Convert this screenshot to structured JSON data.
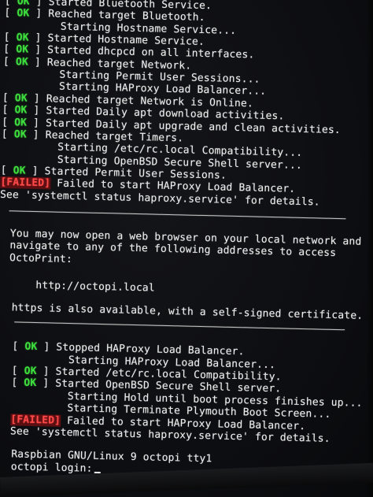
{
  "terminal": {
    "status_ok": "OK",
    "status_failed": "FAILED",
    "lines": [
      {
        "status": "ok",
        "text": "Started Bluetooth Service."
      },
      {
        "status": "ok",
        "text": "Reached target Bluetooth."
      },
      {
        "status": "none",
        "text": "Starting Hostname Service..."
      },
      {
        "status": "ok",
        "text": "Started Hostname Service."
      },
      {
        "status": "ok",
        "text": "Started dhcpcd on all interfaces."
      },
      {
        "status": "ok",
        "text": "Reached target Network."
      },
      {
        "status": "none",
        "text": "Starting Permit User Sessions..."
      },
      {
        "status": "none",
        "text": "Starting HAProxy Load Balancer..."
      },
      {
        "status": "ok",
        "text": "Reached target Network is Online."
      },
      {
        "status": "ok",
        "text": "Started Daily apt download activities."
      },
      {
        "status": "ok",
        "text": "Started Daily apt upgrade and clean activities."
      },
      {
        "status": "ok",
        "text": "Reached target Timers."
      },
      {
        "status": "none",
        "text": "Starting /etc/rc.local Compatibility..."
      },
      {
        "status": "none",
        "text": "Starting OpenBSD Secure Shell server..."
      },
      {
        "status": "ok",
        "text": "Started Permit User Sessions."
      },
      {
        "status": "failed",
        "text": "Failed to start HAProxy Load Balancer."
      },
      {
        "status": "plain",
        "text": "See 'systemctl status haproxy.service' for details."
      }
    ],
    "banner": {
      "line1": "You may now open a web browser on your local network and",
      "line2": "navigate to any of the following addresses to access",
      "line3": "OctoPrint:",
      "url": "http://octopi.local",
      "https_note": "https is also available, with a self-signed certificate."
    },
    "lines2": [
      {
        "status": "ok",
        "text": "Stopped HAProxy Load Balancer."
      },
      {
        "status": "none",
        "text": "Starting HAProxy Load Balancer..."
      },
      {
        "status": "ok",
        "text": "Started /etc/rc.local Compatibility."
      },
      {
        "status": "ok",
        "text": "Started OpenBSD Secure Shell server."
      },
      {
        "status": "none",
        "text": "Starting Hold until boot process finishes up..."
      },
      {
        "status": "none",
        "text": "Starting Terminate Plymouth Boot Screen..."
      },
      {
        "status": "failed",
        "text": "Failed to start HAProxy Load Balancer."
      },
      {
        "status": "plain",
        "text": "See 'systemctl status haproxy.service' for details."
      }
    ],
    "os_banner": "Raspbian GNU/Linux 9 octopi tty1",
    "login_prompt": "octopi login:"
  },
  "colors": {
    "ok": "#3ee03e",
    "failed": "#ff4a4a",
    "text": "#ececec",
    "background": "#0b0c0e"
  }
}
